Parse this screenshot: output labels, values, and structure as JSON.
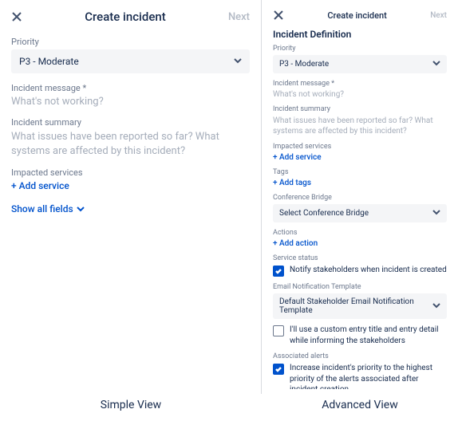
{
  "simple": {
    "title": "Create incident",
    "next": "Next",
    "priority": {
      "label": "Priority",
      "value": "P3 - Moderate"
    },
    "message": {
      "label": "Incident message *",
      "placeholder": "What's not working?"
    },
    "summary": {
      "label": "Incident summary",
      "placeholder": "What issues have been reported so far? What systems are affected by this incident?"
    },
    "services": {
      "label": "Impacted services",
      "add": "+ Add service"
    },
    "show_all": "Show all fields",
    "caption": "Simple View"
  },
  "advanced": {
    "title": "Create incident",
    "next": "Next",
    "section": "Incident Definition",
    "priority": {
      "label": "Priority",
      "value": "P3 - Moderate"
    },
    "message": {
      "label": "Incident message *",
      "placeholder": "What's not working?"
    },
    "summary": {
      "label": "Incident summary",
      "placeholder": "What issues have been reported so far? What systems are affected by this incident?"
    },
    "services": {
      "label": "Impacted services",
      "add": "+ Add service"
    },
    "tags": {
      "label": "Tags",
      "add": "+ Add tags"
    },
    "bridge": {
      "label": "Conference Bridge",
      "value": "Select Conference Bridge"
    },
    "actions": {
      "label": "Actions",
      "add": "+ Add action"
    },
    "status": {
      "label": "Service status",
      "notify": "Notify stakeholders when incident is created"
    },
    "email": {
      "label": "Email Notification Template",
      "value": "Default Stakeholder Email Notification Template",
      "custom": "I'll use a custom entry title and entry detail while informing the stakeholders"
    },
    "alerts": {
      "label": "Associated alerts",
      "increase": "Increase incident's priority to the highest priority of the alerts associated after incident creation"
    },
    "caption": "Advanced View"
  }
}
